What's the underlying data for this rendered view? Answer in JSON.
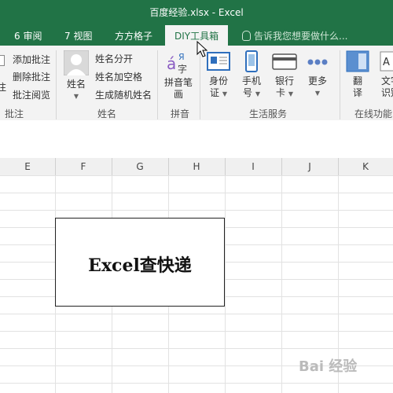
{
  "window": {
    "title": "百度经验.xlsx - Excel"
  },
  "tabs": [
    {
      "label": "6 审阅"
    },
    {
      "label": "7 视图"
    },
    {
      "label": "方方格子"
    },
    {
      "label": "DIY工具箱",
      "active": true
    }
  ],
  "tellme": {
    "placeholder": "告诉我您想要做什么..."
  },
  "ribbon": {
    "comment_group": {
      "items": [
        "添加批注",
        "删除批注",
        "批注阅览"
      ],
      "left_partial": [
        "注",
        "注"
      ],
      "label": "批注"
    },
    "name_group": {
      "big_button": "姓名",
      "items": [
        "姓名分开",
        "姓名加空格",
        "生成随机姓名"
      ],
      "label": "姓名"
    },
    "pinyin_group": {
      "big_button_line1": "拼音笔",
      "big_button_line2": "画",
      "label": "拼音"
    },
    "life_group": {
      "buttons": [
        {
          "line1": "身份",
          "line2": "证"
        },
        {
          "line1": "手机",
          "line2": "号"
        },
        {
          "line1": "银行",
          "line2": "卡"
        },
        {
          "line1": "更多",
          "line2": ""
        }
      ],
      "label": "生活服务"
    },
    "online_group": {
      "buttons": [
        {
          "line1": "翻",
          "line2": "译"
        },
        {
          "line1": "文字",
          "line2": "识别"
        }
      ],
      "label": "在线功能"
    }
  },
  "columns": [
    "E",
    "F",
    "G",
    "H",
    "I",
    "J",
    "K"
  ],
  "textbox": {
    "text": "Excel查快递"
  },
  "watermark": {
    "text": "Bai 经验"
  },
  "colors": {
    "excel_green": "#217346",
    "ribbon_bg": "#f3f3f3"
  }
}
